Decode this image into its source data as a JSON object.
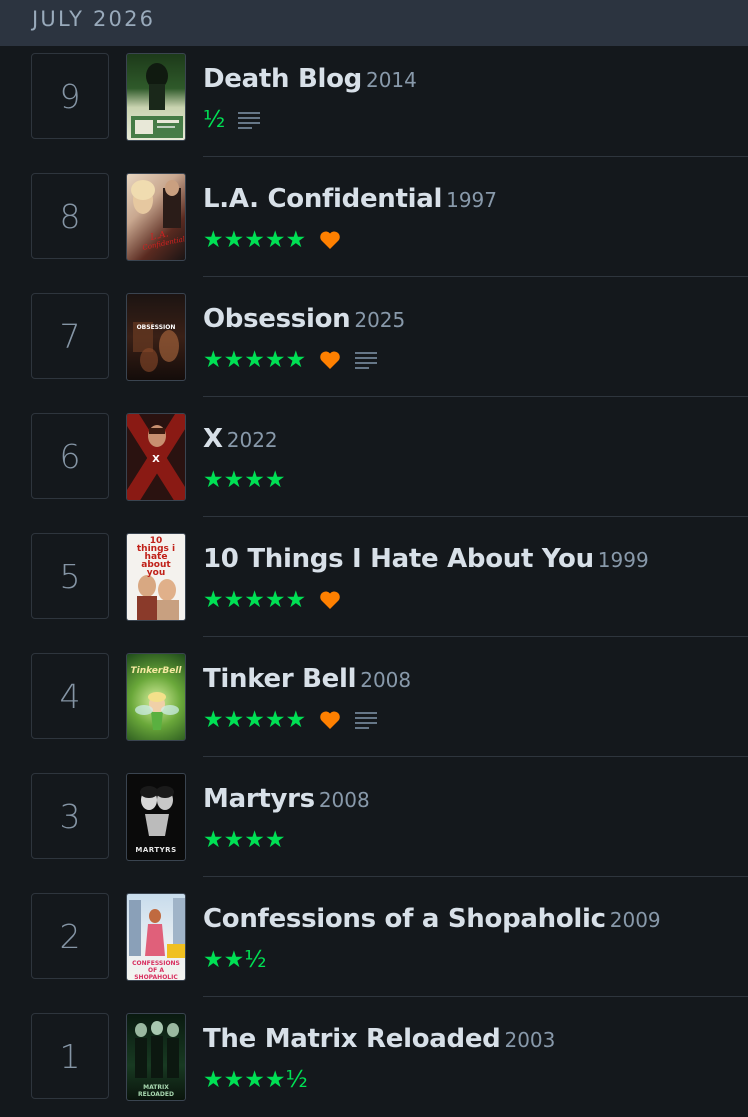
{
  "header": {
    "month": "JULY 2026"
  },
  "colors": {
    "background": "#14181c",
    "header_bg": "#2c3440",
    "star": "#00e054",
    "heart": "#ff8000",
    "review": "#667788"
  },
  "entries": [
    {
      "day": "9",
      "title": "Death Blog",
      "year": "2014",
      "rating": "½",
      "liked": false,
      "reviewed": true,
      "poster_label": ""
    },
    {
      "day": "8",
      "title": "L.A. Confidential",
      "year": "1997",
      "rating": "★★★★★",
      "liked": true,
      "reviewed": false,
      "poster_label": ""
    },
    {
      "day": "7",
      "title": "Obsession",
      "year": "2025",
      "rating": "★★★★★",
      "liked": true,
      "reviewed": true,
      "poster_label": "OBSESSION"
    },
    {
      "day": "6",
      "title": "X",
      "year": "2022",
      "rating": "★★★★",
      "liked": false,
      "reviewed": false,
      "poster_label": "X"
    },
    {
      "day": "5",
      "title": "10 Things I Hate About You",
      "year": "1999",
      "rating": "★★★★★",
      "liked": true,
      "reviewed": false,
      "poster_label": "10 things i hate about you"
    },
    {
      "day": "4",
      "title": "Tinker Bell",
      "year": "2008",
      "rating": "★★★★★",
      "liked": true,
      "reviewed": true,
      "poster_label": "TinkerBell"
    },
    {
      "day": "3",
      "title": "Martyrs",
      "year": "2008",
      "rating": "★★★★",
      "liked": false,
      "reviewed": false,
      "poster_label": "MARTYRS"
    },
    {
      "day": "2",
      "title": "Confessions of a Shopaholic",
      "year": "2009",
      "rating": "★★½",
      "liked": false,
      "reviewed": false,
      "poster_label": "CONFESSIONS OF A SHOPAHOLIC"
    },
    {
      "day": "1",
      "title": "The Matrix Reloaded",
      "year": "2003",
      "rating": "★★★★½",
      "liked": false,
      "reviewed": false,
      "poster_label": "MATRIX RELOADED"
    }
  ]
}
